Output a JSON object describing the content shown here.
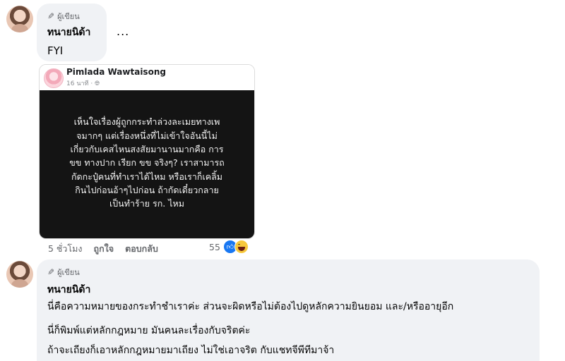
{
  "comment1": {
    "author_badge": "ผู้เขียน",
    "author_name": "ทนายนิด้า",
    "text": "FYI",
    "more": "...",
    "shared_post": {
      "name": "Pimlada Wawtaisong",
      "time": "16 นาที · ",
      "body": "เห็นใจเรื่องผู้ถูกกระทำล่วงละเมยทางเพ\nจมากๆ แต่เรื่องหนึ่งที่ไม่เข้าใจอันนี้ไม่\nเกี่ยวกับเคสไหนสงสัยมานานมากคือ การ\nขข ทางปาก เรียก ขข จริงๆ? เราสามารถ\nกัดกะปู๋คนที่ทำเราได้ไหม หรือเราก็เคลิ้ม\nกินไปก่อนอ้าๆไปก่อน ถ้ากัดเดี๋ยวกลาย\nเป็นทำร้าย รก. ไหม"
    },
    "actions": {
      "time": "5 ชั่วโมง",
      "like": "ถูกใจ",
      "reply": "ตอบกลับ",
      "reaction_count": "55"
    }
  },
  "comment2": {
    "author_badge": "ผู้เขียน",
    "author_name": "ทนายนิด้า",
    "lines": [
      "นี่คือความหมายของกระทำชำเราค่ะ ส่วนจะผิดหรือไม่ต้องไปดูหลักความยินยอม และ/หรืออายุอีก",
      "นี่ก็พิมพ์แต่หลักกฎหมาย มันคนละเรื่องกับจริตค่ะ",
      "ถ้าจะเถียงก็เอาหลักกฎหมายมาเถียง ไม่ใช่เอาจริต กับแชทจีพีทีมาจ้า"
    ]
  },
  "icons": {
    "pencil": "pencil-icon",
    "globe": "globe-icon",
    "like": "like-reaction-icon",
    "haha": "haha-reaction-icon"
  }
}
